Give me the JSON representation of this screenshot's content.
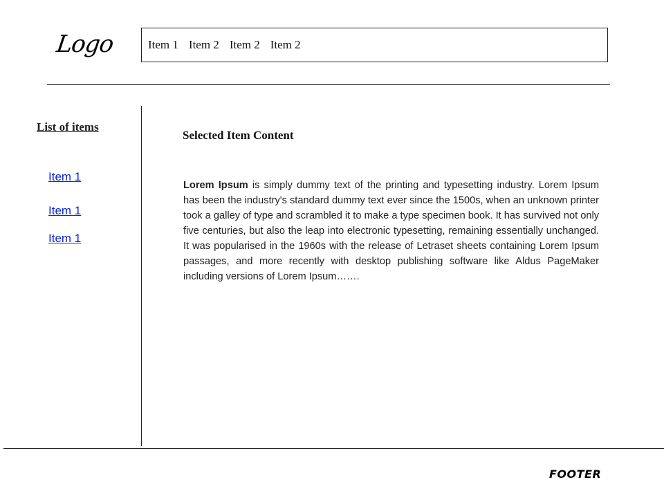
{
  "header": {
    "logo": "Logo",
    "nav": [
      {
        "label": "Item 1"
      },
      {
        "label": "Item 2"
      },
      {
        "label": "Item 2"
      },
      {
        "label": "Item 2"
      }
    ]
  },
  "sidebar": {
    "title": "List of items",
    "items": [
      {
        "label": "Item 1"
      },
      {
        "label": "Item 1"
      },
      {
        "label": "Item 1"
      }
    ]
  },
  "main": {
    "title": "Selected Item Content",
    "body_lead": "Lorem Ipsum",
    "body_text": " is simply dummy text of the printing and typesetting industry. Lorem Ipsum has been the industry's standard dummy text ever since the 1500s, when an unknown printer took a galley of type and scrambled it to make a type specimen book. It has survived not only five centuries, but also the leap into electronic typesetting, remaining essentially unchanged. It was popularised in the 1960s with the release of Letraset sheets containing Lorem Ipsum passages, and more recently with desktop publishing software like Aldus PageMaker including versions of Lorem Ipsum……."
  },
  "footer": {
    "label": "FOOTER"
  },
  "colors": {
    "link": "#0b24d6",
    "line": "#222222",
    "background": "#ffffff"
  }
}
